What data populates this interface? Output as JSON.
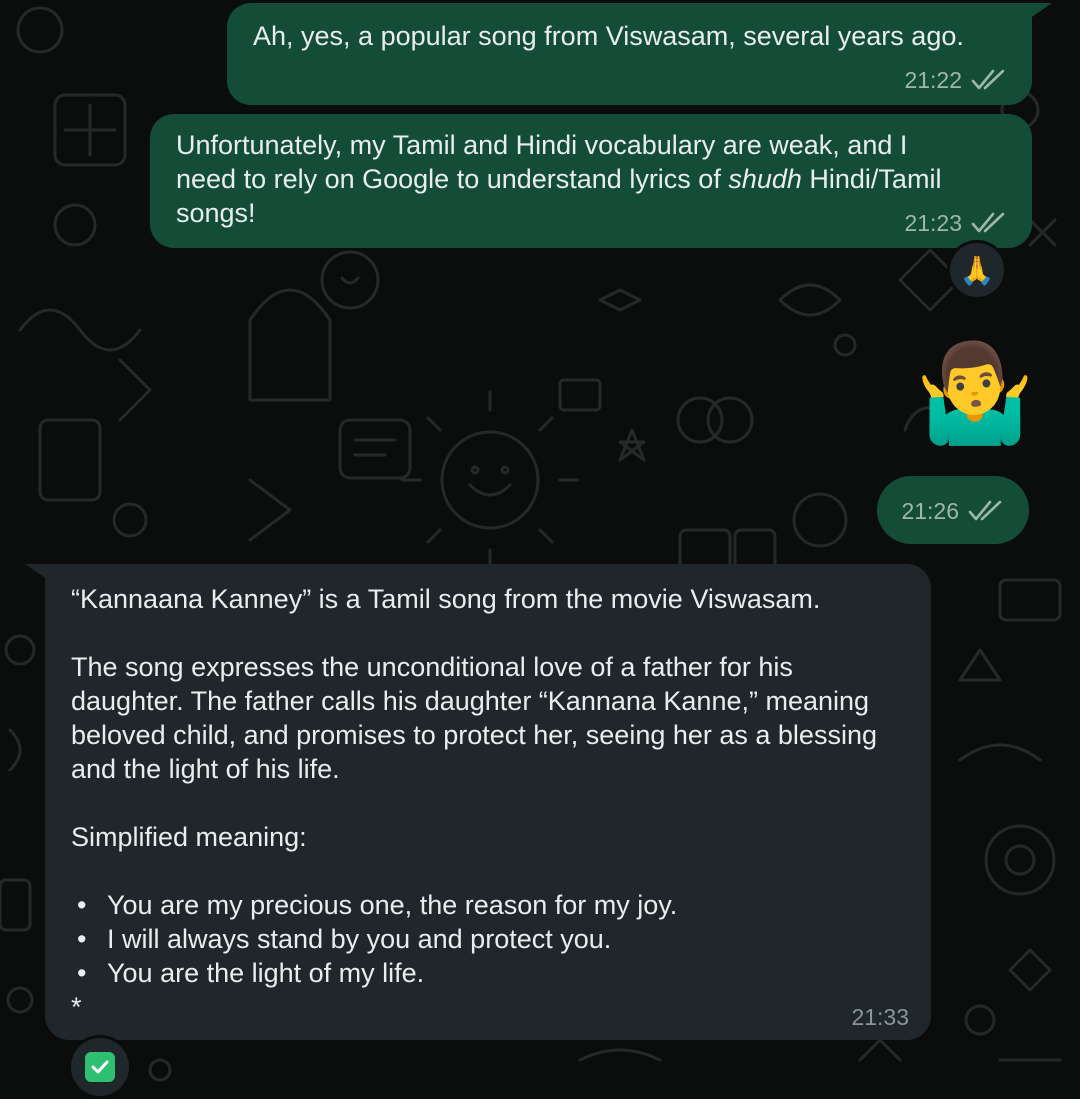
{
  "messages": [
    {
      "type": "outgoing",
      "text": "Ah, yes, a popular song from Viswasam, several years ago.",
      "time": "21:22"
    },
    {
      "type": "outgoing",
      "text_before": "Unfortunately, my Tamil and Hindi vocabulary are weak, and I need to rely on Google to understand lyrics of ",
      "text_italic": "shudh",
      "text_after": " Hindi/Tamil songs!",
      "time": "21:23",
      "reaction": "🙏"
    },
    {
      "type": "outgoing-sticker",
      "sticker": "🤷‍♂️",
      "time": "21:26"
    },
    {
      "type": "incoming",
      "paragraphs": [
        "“Kannaana Kanney” is a Tamil song from the movie Viswasam.",
        "The song expresses the unconditional love of a father for his daughter. The father calls his daughter “Kannana Kanne,” meaning beloved child, and promises to protect her, seeing her as a blessing and the light of his life.",
        "Simplified meaning:"
      ],
      "bullets": [
        "You are my precious one, the reason for my joy.",
        "I will always stand by you and protect you.",
        "You are the light of my life."
      ],
      "trailing": "*",
      "time": "21:33",
      "reaction": "check-mark-button-icon"
    }
  ],
  "colors": {
    "outgoing_bubble": "#144d37",
    "incoming_bubble": "#1f272a",
    "background": "#0b0d0c",
    "read_ticks": "#9fb6ac",
    "check_green": "#2fbf71"
  }
}
